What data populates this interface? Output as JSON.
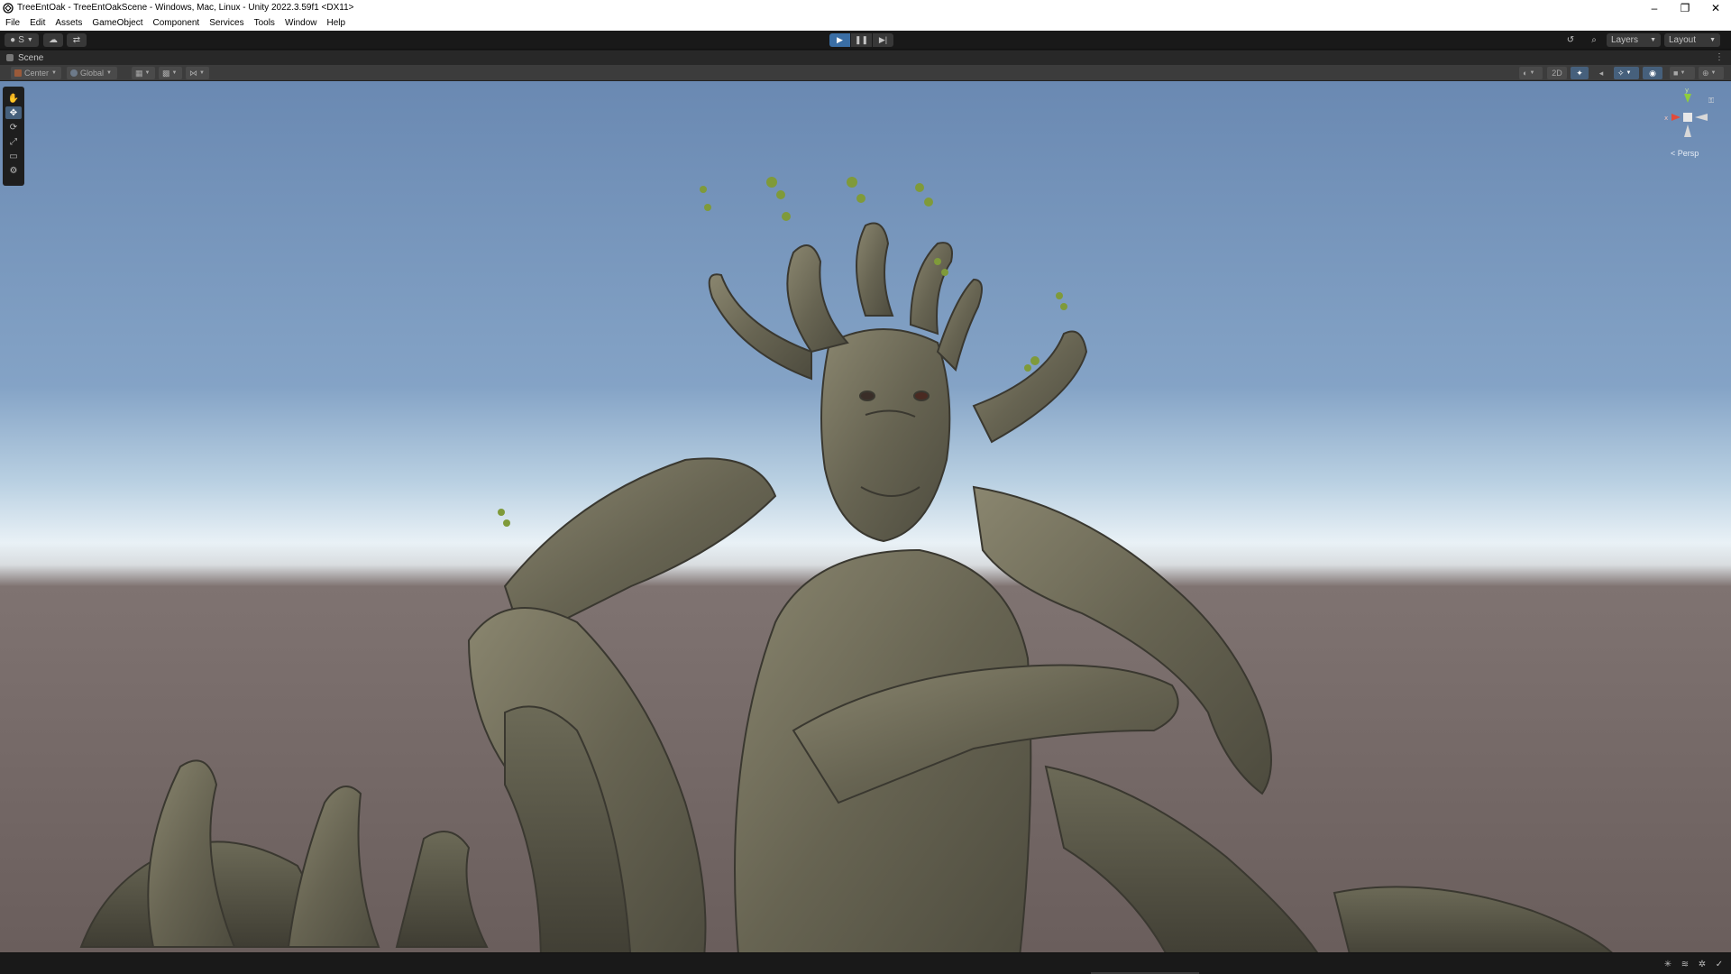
{
  "window": {
    "title": "TreeEntOak - TreeEntOakScene - Windows, Mac, Linux - Unity 2022.3.59f1 <DX11>",
    "minimize": "–",
    "restore": "❐",
    "close": "✕"
  },
  "menu": [
    "File",
    "Edit",
    "Assets",
    "GameObject",
    "Component",
    "Services",
    "Tools",
    "Window",
    "Help"
  ],
  "toolbar": {
    "account_label": "S",
    "cloud_icon": "cloud-icon",
    "collab_icon": "version-control-icon",
    "play_icon": "▶",
    "pause_icon": "❚❚",
    "step_icon": "▶|",
    "history_icon": "↺",
    "search_icon": "⌕",
    "layers_label": "Layers",
    "layout_label": "Layout"
  },
  "scene_tab": {
    "label": "Scene",
    "more": "⋮"
  },
  "scene_toolbar": {
    "pivot_label": "Center",
    "handle_label": "Global",
    "mode_2d_label": "2D"
  },
  "tools": [
    "✋",
    "✥",
    "⟳",
    "⤢",
    "▭",
    "⚙"
  ],
  "gizmo": {
    "x_label": "x",
    "y_label": "y",
    "projection_label": "< Persp"
  },
  "colors": {
    "play_active": "#3a6ea5",
    "editor_dark": "#191919",
    "panel": "#3c3c3c",
    "sky_top": "#6e8db4",
    "horizon": "#e9f1f6",
    "ground": "#6d615f",
    "bark": "#6f6b5c"
  },
  "status_icons": [
    "bug-icon",
    "layers-status-icon",
    "network-icon",
    "check-icon"
  ]
}
